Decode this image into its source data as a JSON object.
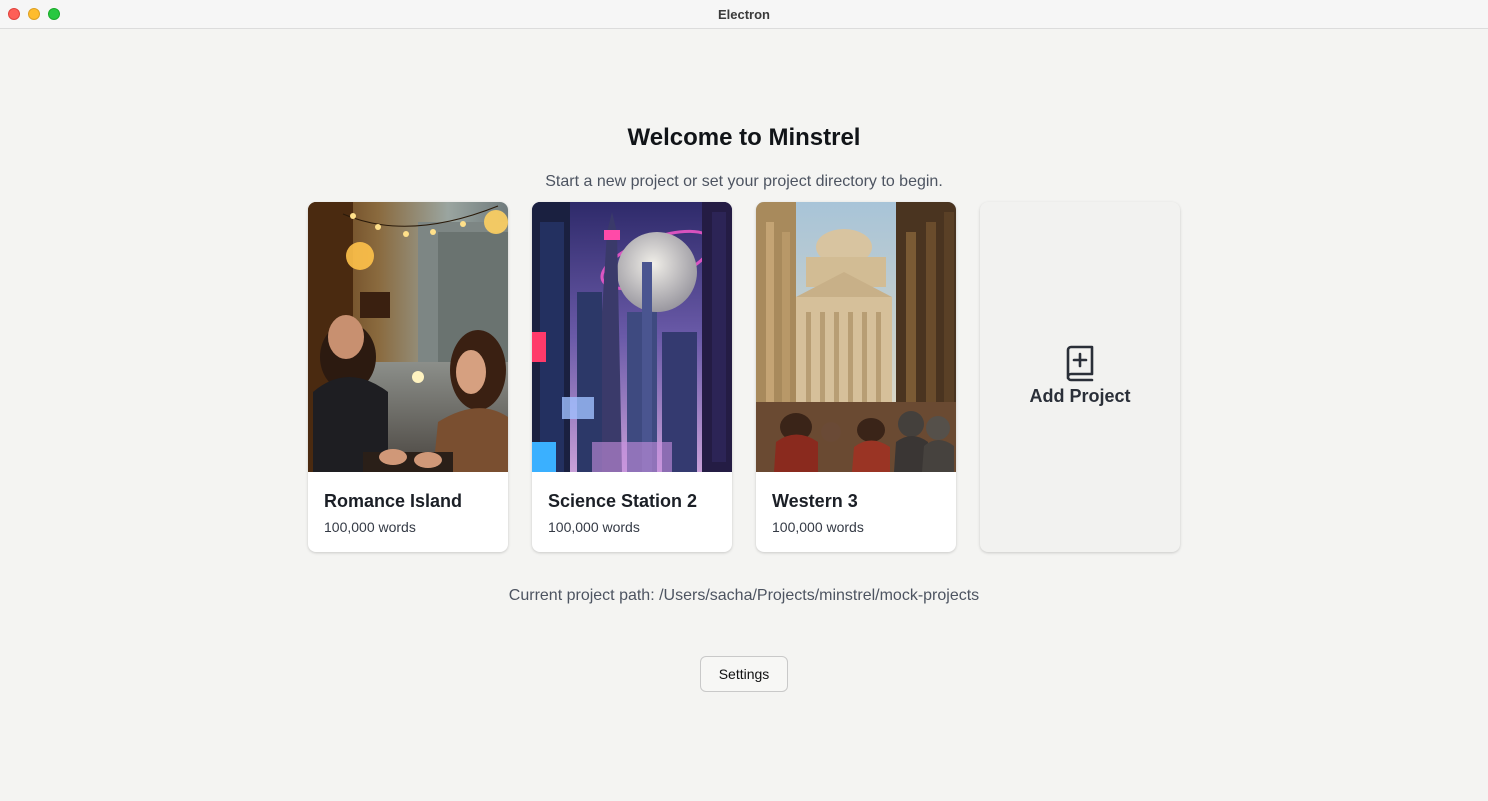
{
  "window": {
    "title": "Electron"
  },
  "welcome": {
    "heading": "Welcome to Minstrel",
    "subtitle": "Start a new project or set your project directory to begin."
  },
  "projects": [
    {
      "title": "Romance Island",
      "words": "100,000 words",
      "image": "couple-at-cafe-image"
    },
    {
      "title": "Science Station 2",
      "words": "100,000 words",
      "image": "futuristic-city-moon-image"
    },
    {
      "title": "Western 3",
      "words": "100,000 words",
      "image": "roman-crowd-temple-image"
    }
  ],
  "add_project": {
    "label": "Add Project",
    "icon": "book-plus-icon"
  },
  "footer": {
    "path": "Current project path: /Users/sacha/Projects/minstrel/mock-projects",
    "settings_label": "Settings"
  },
  "colors": {
    "background": "#f4f4f2",
    "card": "#ffffff",
    "heading": "#111418",
    "muted_text": "#4d5461"
  }
}
